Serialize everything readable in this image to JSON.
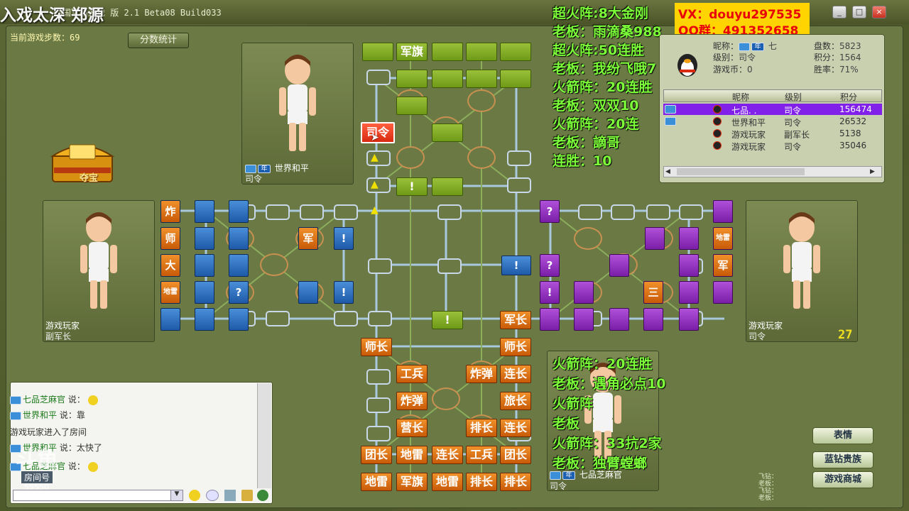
{
  "window": {
    "title": "四国军棋游戏 版 2.1 Beta08 Build033",
    "overlay_title": "入戏太深 郑源",
    "minimize_label": "_",
    "maximize_label": "□",
    "close_label": "×"
  },
  "game": {
    "steps_label": "当前游戏步数：69",
    "stats_button": "分数统计",
    "treasure_label": "夺宝",
    "timer": "27"
  },
  "players": {
    "top": {
      "name": "世界和平",
      "rank": "司令"
    },
    "left": {
      "name": "游戏玩家",
      "rank": "副军长"
    },
    "right": {
      "name": "游戏玩家",
      "rank": "司令"
    },
    "bottom": {
      "name": "七品芝麻官",
      "rank": "司令"
    }
  },
  "overlay_right": [
    "超火阵:8大金刚",
    "老板：雨滴桑988",
    "超火阵:50连胜",
    "老板：我纷飞哦7",
    "火箭阵：20连胜（阿7+双）",
    "老板：双双10",
    "火箭阵：20连",
    "老板：謫哥",
    "连胜：10"
  ],
  "overlay_bottom": [
    "火箭阵：20连胜",
    "老板：遇角必点10",
    "火箭阵",
    "老板",
    "火箭阵：33抗2家",
    "老板：独臂螳螂"
  ],
  "contact": {
    "vx": "VX：douyu297535",
    "qq": "QQ群：491352658"
  },
  "info_panel": {
    "nickname_label": "昵称：",
    "nickname_value": "七",
    "level_label": "级别：",
    "level_value": "司令",
    "coins_label": "游戏币：",
    "coins_value": "0",
    "games_label": "盘数：",
    "games_value": "5823",
    "score_label": "积分：",
    "score_value": "1564",
    "winrate_label": "胜率：",
    "winrate_value": "71%",
    "headers": [
      "昵称",
      "级别",
      "积分"
    ],
    "rows": [
      {
        "name": "七品. .",
        "rank": "司令",
        "score": "156474"
      },
      {
        "name": "世界和平",
        "rank": "司令",
        "score": "26532"
      },
      {
        "name": "游戏玩家",
        "rank": "副军长",
        "score": "5138"
      },
      {
        "name": "游戏玩家",
        "rank": "司令",
        "score": "35046"
      }
    ]
  },
  "chat": {
    "lines": [
      {
        "name": "七品芝麻官",
        "text": " 说："
      },
      {
        "name": "世界和平",
        "text": " 说：靠"
      },
      {
        "name": "",
        "text": "游戏玩家进入了房间"
      },
      {
        "name": "世界和平",
        "text": " 说：太快了"
      },
      {
        "name": "七品芝麻官",
        "text": " 说："
      }
    ],
    "room_label": "房间号",
    "room_value": "55550",
    "watermark": "斗鱼"
  },
  "buttons": {
    "emotion": "表情",
    "diamond": "蓝钻贵族",
    "store": "游戏商城"
  },
  "small_labels": [
    "飞钻：",
    "老板：",
    "飞钻：",
    "老板："
  ],
  "colors": {
    "green_army": "#7eaa22",
    "orange_army": "#e07a1a",
    "blue_army": "#2f72c4",
    "purple_army": "#9430c0",
    "overlay_text": "#7dff3a",
    "contact_bg": "#ffd400",
    "contact_text": "#e8000a"
  },
  "board": {
    "green_pieces": [
      {
        "label": ""
      },
      {
        "label": "军旗"
      },
      {
        "label": ""
      },
      {
        "label": ""
      },
      {
        "label": ""
      },
      {
        "label": ""
      },
      {
        "label": ""
      },
      {
        "label": ""
      },
      {
        "label": ""
      },
      {
        "label": ""
      },
      {
        "label": ""
      },
      {
        "label": "!"
      },
      {
        "label": ""
      }
    ],
    "selected_piece": "司令",
    "blue_pieces": [
      {
        "label": "炸"
      },
      {
        "label": ""
      },
      {
        "label": "!"
      },
      {
        "label": ""
      },
      {
        "label": "师"
      },
      {
        "label": ""
      },
      {
        "label": ""
      },
      {
        "label": "军"
      },
      {
        "label": "!"
      },
      {
        "label": "大"
      },
      {
        "label": ""
      },
      {
        "label": ""
      },
      {
        "label": "地雷"
      },
      {
        "label": ""
      },
      {
        "label": "?"
      },
      {
        "label": ""
      },
      {
        "label": "!"
      },
      {
        "label": ""
      },
      {
        "label": ""
      },
      {
        "label": ""
      }
    ],
    "purple_pieces": [
      {
        "label": "?"
      },
      {
        "label": ""
      },
      {
        "label": ""
      },
      {
        "label": ""
      },
      {
        "label": "地雷"
      },
      {
        "label": "?"
      },
      {
        "label": ""
      },
      {
        "label": ""
      },
      {
        "label": "军"
      },
      {
        "label": "!"
      },
      {
        "label": ""
      },
      {
        "label": "三"
      },
      {
        "label": ""
      },
      {
        "label": ""
      },
      {
        "label": ""
      },
      {
        "label": ""
      },
      {
        "label": ""
      },
      {
        "label": ""
      },
      {
        "label": ""
      }
    ],
    "blue_center_piece": "!",
    "green_center_piece": "!",
    "orange_pieces": [
      {
        "label": "军长"
      },
      {
        "label": "师长"
      },
      {
        "label": "师长"
      },
      {
        "label": "工兵"
      },
      {
        "label": "炸弹"
      },
      {
        "label": "连长"
      },
      {
        "label": "炸弹"
      },
      {
        "label": "旅长"
      },
      {
        "label": "营长"
      },
      {
        "label": "排长"
      },
      {
        "label": "连长"
      },
      {
        "label": "团长"
      },
      {
        "label": "地雷"
      },
      {
        "label": "连长"
      },
      {
        "label": "工兵"
      },
      {
        "label": "团长"
      },
      {
        "label": "地雷"
      },
      {
        "label": "军旗"
      },
      {
        "label": "地雷"
      },
      {
        "label": "排长"
      },
      {
        "label": "排长"
      }
    ]
  }
}
